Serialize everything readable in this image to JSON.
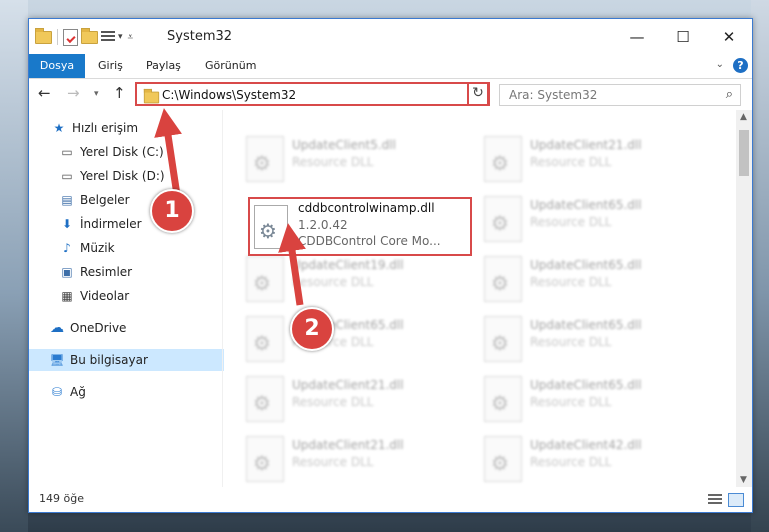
{
  "window": {
    "title": "System32",
    "minimize": "—",
    "maximize": "☐",
    "close": "✕"
  },
  "ribbon": {
    "tabs": [
      "Dosya",
      "Giriş",
      "Paylaş",
      "Görünüm"
    ],
    "help": "?"
  },
  "nav": {
    "address": "C:\\Windows\\System32",
    "search_placeholder": "Ara: System32"
  },
  "sidebar": {
    "quick_access": "Hızlı erişim",
    "items": [
      {
        "label": "Yerel Disk (C:)",
        "icon": "drive-icon"
      },
      {
        "label": "Yerel Disk (D:)",
        "icon": "drive-icon"
      },
      {
        "label": "Belgeler",
        "icon": "documents-icon"
      },
      {
        "label": "İndirmeler",
        "icon": "downloads-icon"
      },
      {
        "label": "Müzik",
        "icon": "music-icon"
      },
      {
        "label": "Resimler",
        "icon": "pictures-icon"
      },
      {
        "label": "Videolar",
        "icon": "videos-icon"
      }
    ],
    "onedrive": "OneDrive",
    "this_pc": "Bu bilgisayar",
    "network": "Ağ"
  },
  "files": {
    "highlighted": {
      "name": "cddbcontrolwinamp.dll",
      "version": "1.2.0.42",
      "description": "CDDBControl Core Mo..."
    },
    "left_column": [
      {
        "name": "UpdateClient5.dll",
        "desc": "Resource DLL"
      },
      {
        "name": "UpdateClient19.dll",
        "desc": "Resource DLL"
      },
      {
        "name": "UpdateClient65.dll",
        "desc": "Resource DLL"
      },
      {
        "name": "UpdateClient21.dll",
        "desc": "Resource DLL"
      },
      {
        "name": "UpdateClient21.dll",
        "desc": "Resource DLL"
      }
    ],
    "right_column": [
      {
        "name": "UpdateClient21.dll",
        "desc": "Resource DLL"
      },
      {
        "name": "UpdateClient65.dll",
        "desc": "Resource DLL"
      },
      {
        "name": "UpdateClient65.dll",
        "desc": "Resource DLL"
      },
      {
        "name": "UpdateClient65.dll",
        "desc": "Resource DLL"
      },
      {
        "name": "UpdateClient65.dll",
        "desc": "Resource DLL"
      },
      {
        "name": "UpdateClient42.dll",
        "desc": "Resource DLL"
      }
    ]
  },
  "status": {
    "count": "149 öğe"
  },
  "annotations": {
    "step1": "1",
    "step2": "2",
    "color": "#d9433f"
  }
}
